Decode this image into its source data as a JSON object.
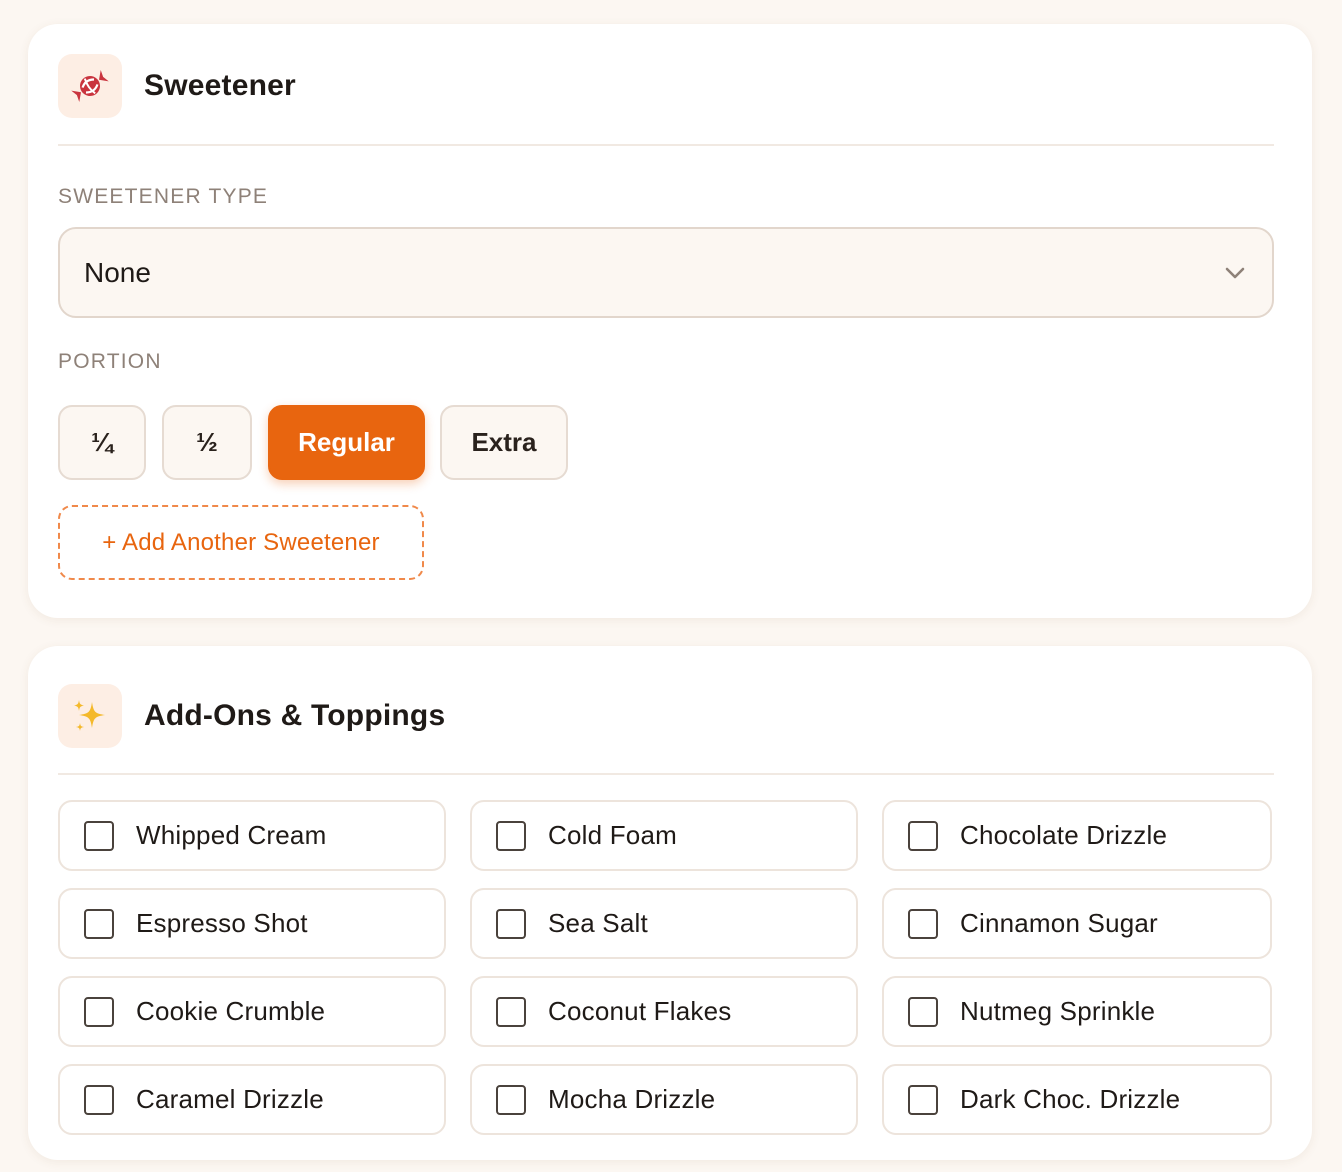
{
  "sweetener": {
    "title": "Sweetener",
    "icon": "candy-icon",
    "type_label": "SWEETENER TYPE",
    "selected_type": "None",
    "portion_label": "PORTION",
    "portions": [
      "¼",
      "½",
      "Regular",
      "Extra"
    ],
    "selected_portion": "Regular",
    "add_label": "+ Add Another Sweetener"
  },
  "addons": {
    "title": "Add-Ons & Toppings",
    "icon": "sparkles-icon",
    "items": [
      "Whipped Cream",
      "Cold Foam",
      "Chocolate Drizzle",
      "Espresso Shot",
      "Sea Salt",
      "Cinnamon Sugar",
      "Cookie Crumble",
      "Coconut Flakes",
      "Nutmeg Sprinkle",
      "Caramel Drizzle",
      "Mocha Drizzle",
      "Dark Choc. Drizzle"
    ]
  },
  "colors": {
    "accent": "#e8650f",
    "background": "#fcf7f2",
    "icon_tile": "#fdeee4"
  }
}
